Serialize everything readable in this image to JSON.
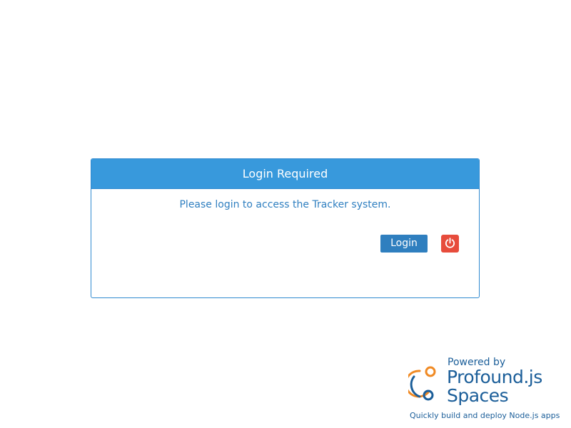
{
  "dialog": {
    "title": "Login Required",
    "message": "Please login to access the Tracker system.",
    "login_label": "Login",
    "power_icon": "power-icon"
  },
  "brand": {
    "powered_by": "Powered by",
    "name": "Profound.js",
    "product": "Spaces",
    "tagline": "Quickly build and deploy Node.js apps"
  },
  "colors": {
    "header_bg": "#3899dc",
    "border": "#2f8ad0",
    "message_text": "#2f7fc0",
    "login_button_bg": "#2f7fbf",
    "power_button_bg": "#e74c3c",
    "brand_blue": "#1b5e99",
    "brand_orange": "#f08a24"
  }
}
